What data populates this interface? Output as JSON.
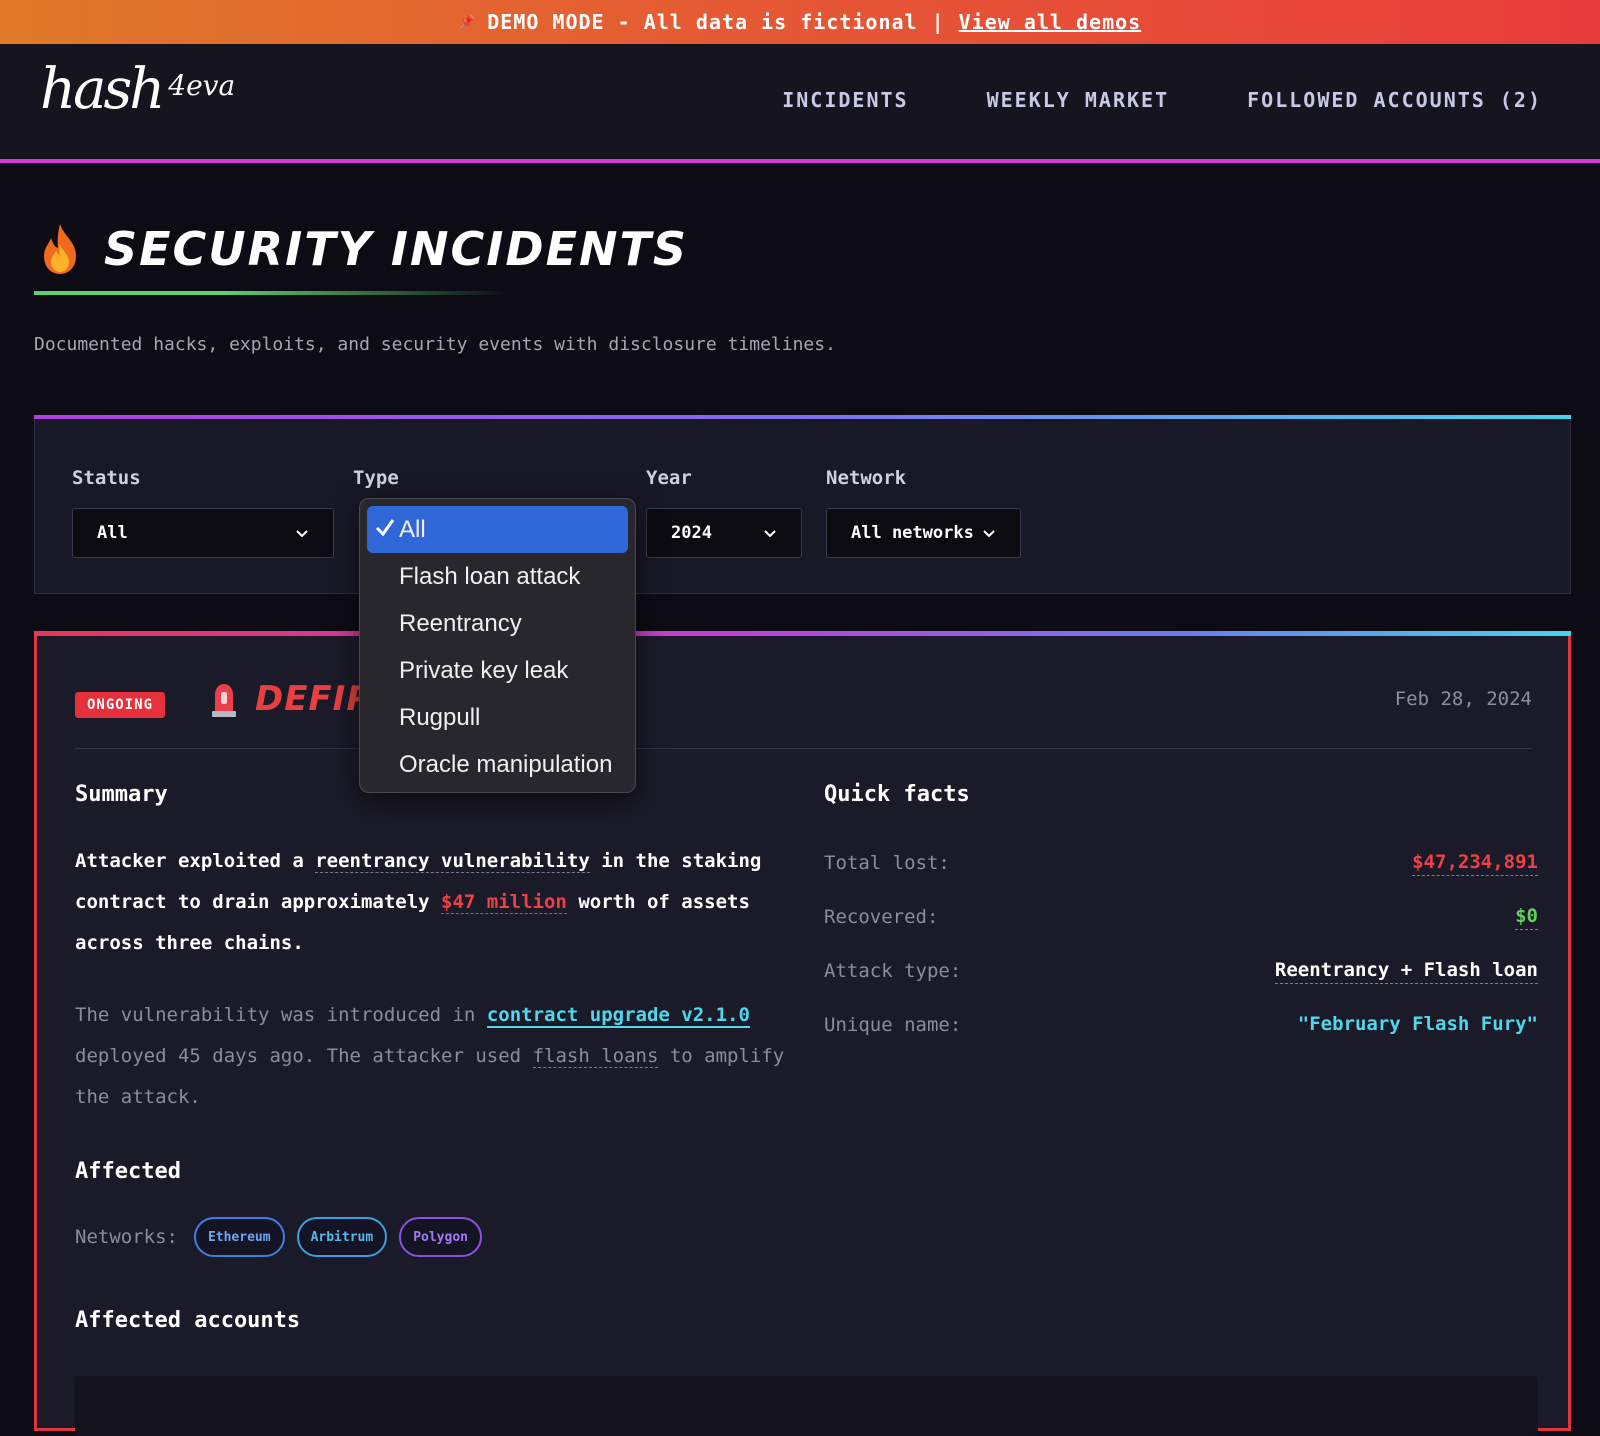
{
  "banner": {
    "icon": "pin-icon",
    "text": "DEMO MODE - All data is fictional",
    "separator": "|",
    "link": "View all demos"
  },
  "logo": {
    "main": "hash",
    "suffix": "4eva"
  },
  "nav": [
    "INCIDENTS",
    "WEEKLY MARKET",
    "FOLLOWED ACCOUNTS (2)"
  ],
  "page": {
    "title": "SECURITY INCIDENTS",
    "subtitle": "Documented hacks, exploits, and security events with disclosure timelines."
  },
  "filters": {
    "status": {
      "label": "Status",
      "value": "All"
    },
    "type": {
      "label": "Type",
      "value": "All"
    },
    "year": {
      "label": "Year",
      "value": "2024"
    },
    "network": {
      "label": "Network",
      "value": "All networks"
    }
  },
  "type_dropdown": {
    "options": [
      "All",
      "Flash loan attack",
      "Reentrancy",
      "Private key leak",
      "Rugpull",
      "Oracle manipulation"
    ],
    "selected": "All"
  },
  "incident": {
    "status": "ONGOING",
    "title": "DEFIPR",
    "date": "Feb 28, 2024",
    "summary_heading": "Summary",
    "summary_p1": {
      "t1": "Attacker exploited a ",
      "hl1": "reentrancy vulnerability",
      "t2": " in the staking contract to drain approximately ",
      "hl2": "$47 million",
      "t3": " worth of assets across three chains."
    },
    "summary_p2": {
      "t1": "The vulnerability was introduced in ",
      "link": "contract upgrade v2.1.0",
      "t2": " deployed 45 days ago. The attacker used ",
      "hl": "flash loans",
      "t3": " to amplify the attack."
    },
    "facts_heading": "Quick facts",
    "facts": [
      {
        "label": "Total lost:",
        "value": "$47,234,891"
      },
      {
        "label": "Recovered:",
        "value": "$0"
      },
      {
        "label": "Attack type:",
        "value": "Reentrancy + Flash loan"
      },
      {
        "label": "Unique name:",
        "value": "\"February Flash Fury\""
      }
    ],
    "affected_heading": "Affected",
    "networks_label": "Networks:",
    "networks": [
      "Ethereum",
      "Arbitrum",
      "Polygon"
    ],
    "accounts_heading": "Affected accounts"
  },
  "colors": {
    "accent_magenta": "#d43ad8",
    "danger": "#e6303c",
    "success": "#5fd15c",
    "link": "#4fd8ec",
    "dropdown_selected": "#2f67d6"
  }
}
